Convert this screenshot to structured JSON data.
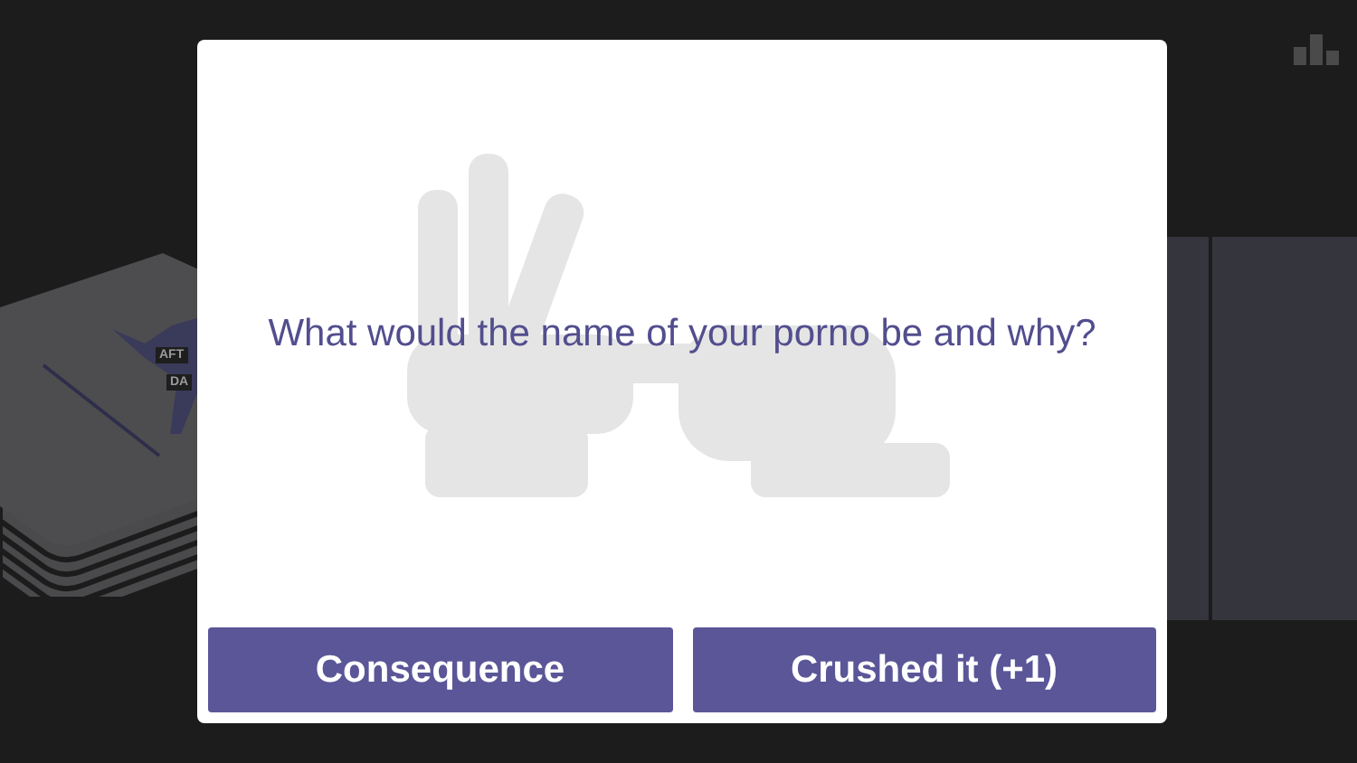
{
  "background_card": {
    "labels": [
      "AFT",
      "DA"
    ]
  },
  "dialog": {
    "question": "What would the name of your porno be and why?",
    "buttons": [
      "Consequence",
      "Crushed it (+1)"
    ]
  }
}
